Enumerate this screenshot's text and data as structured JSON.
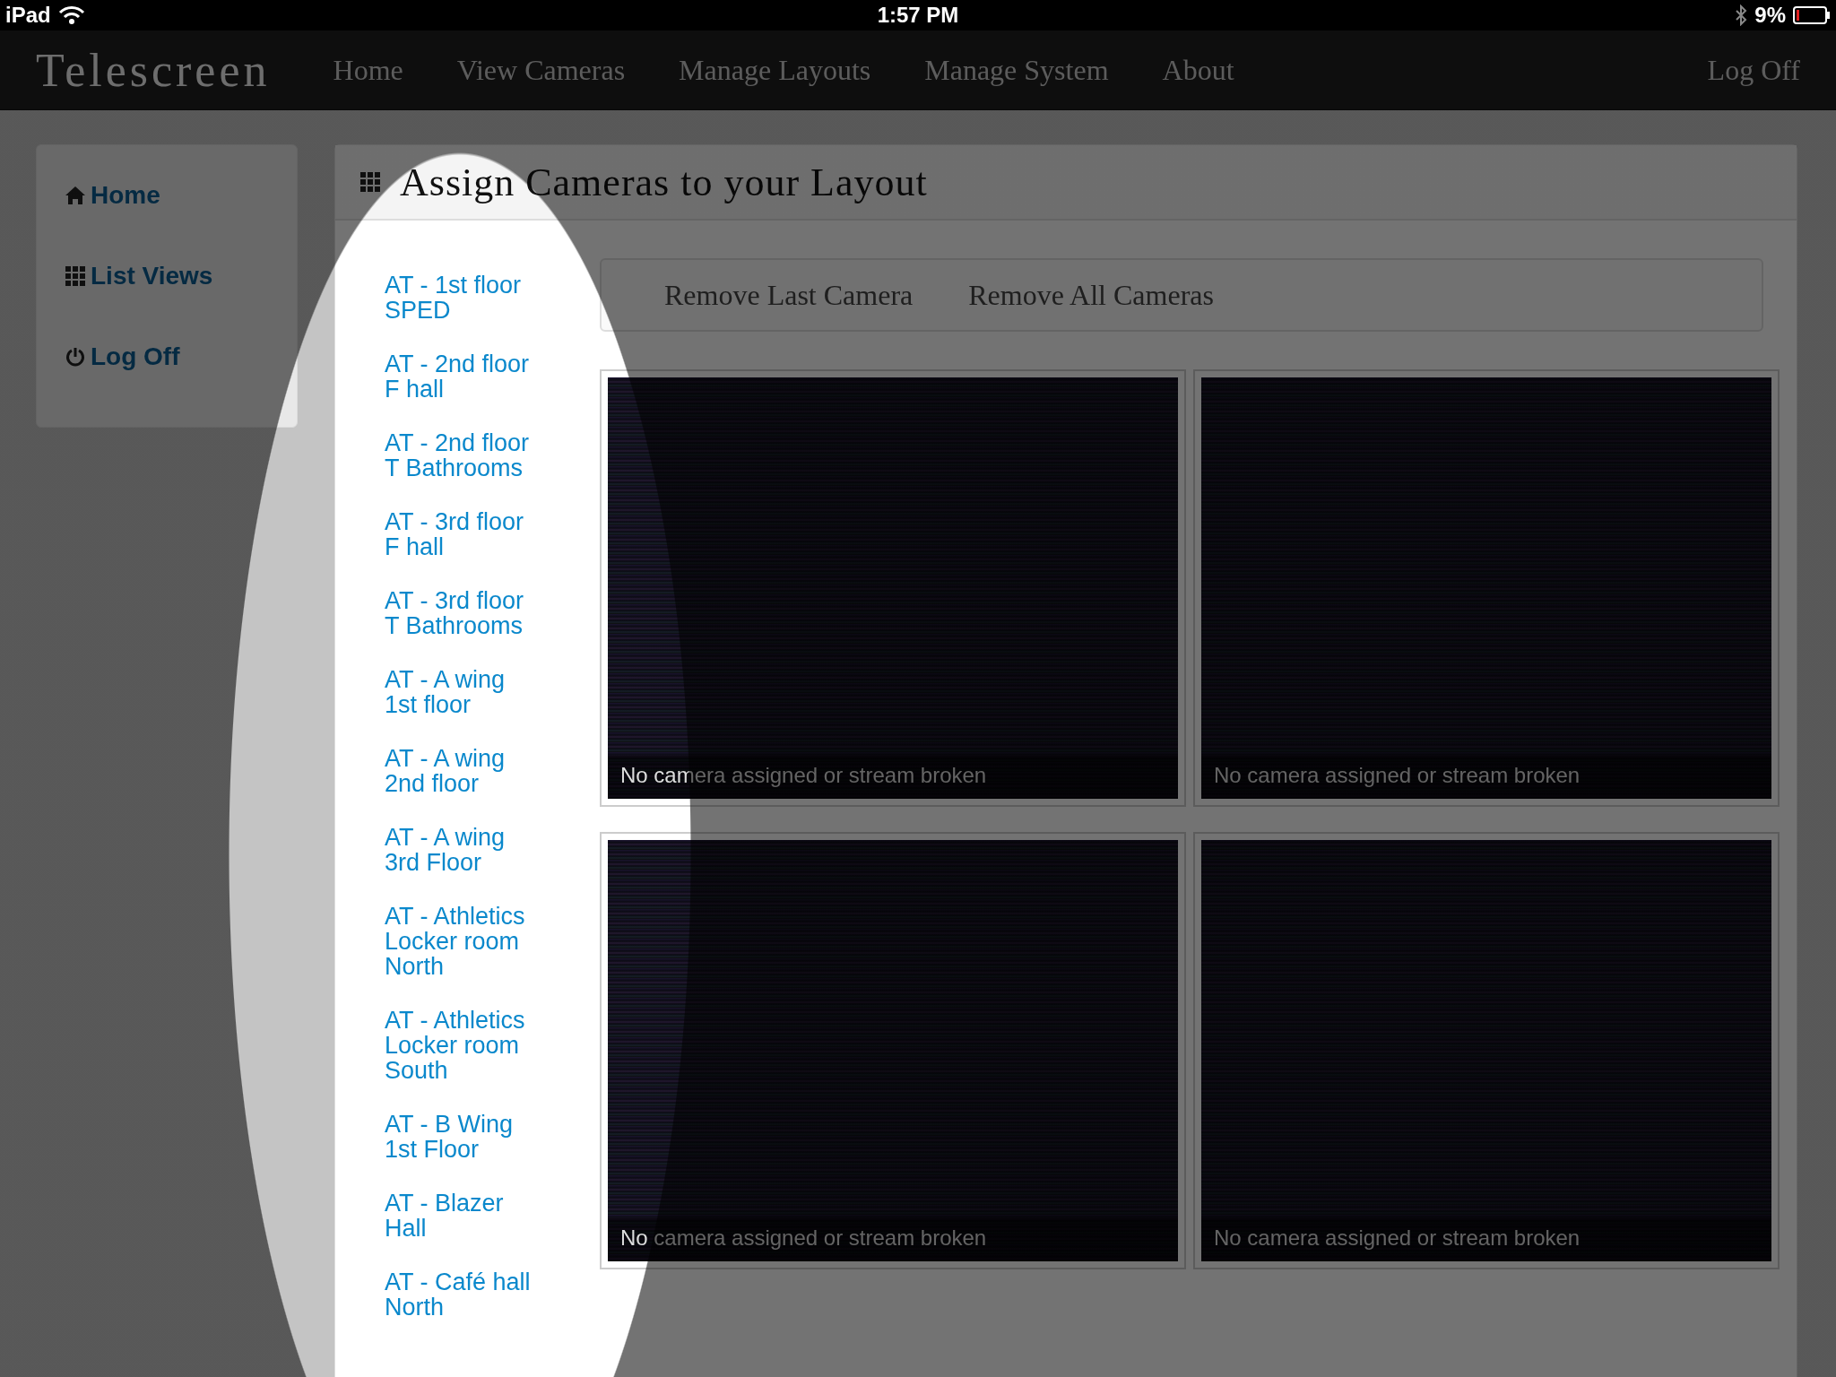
{
  "status_bar": {
    "device": "iPad",
    "time": "1:57 PM",
    "battery": "9%"
  },
  "navbar": {
    "brand": "Telescreen",
    "items": [
      "Home",
      "View Cameras",
      "Manage Layouts",
      "Manage System",
      "About"
    ],
    "log_off": "Log Off"
  },
  "sidebar": {
    "items": [
      {
        "label": "Home"
      },
      {
        "label": "List Views"
      },
      {
        "label": "Log Off"
      }
    ]
  },
  "panel": {
    "title": "Assign Cameras to your Layout",
    "cameras": [
      "AT - 1st floor SPED",
      "AT - 2nd floor F hall",
      "AT - 2nd floor T Bathrooms",
      "AT - 3rd floor F hall",
      "AT - 3rd floor T Bathrooms",
      "AT - A wing 1st floor",
      "AT - A wing 2nd floor",
      "AT - A wing 3rd Floor",
      "AT - Athletics Locker room North",
      "AT - Athletics Locker room South",
      "AT - B Wing 1st Floor",
      "AT - Blazer Hall",
      "AT - Café hall North"
    ],
    "toolbar": [
      "Remove Last Camera",
      "Remove All Cameras"
    ],
    "tiles": [
      {
        "caption": "No camera assigned or stream broken"
      },
      {
        "caption": "No camera assigned or stream broken"
      },
      {
        "caption": "No camera assigned or stream broken"
      },
      {
        "caption": "No camera assigned or stream broken"
      }
    ]
  }
}
